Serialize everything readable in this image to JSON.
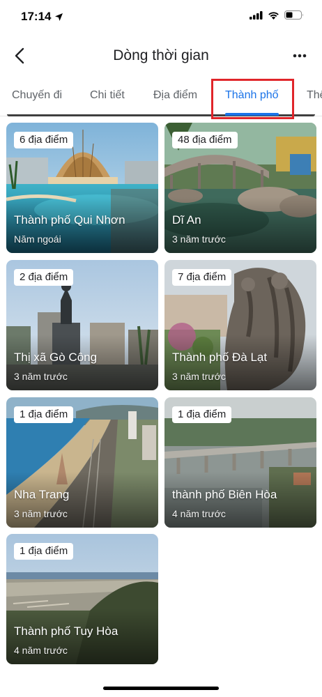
{
  "status_bar": {
    "time": "17:14"
  },
  "header": {
    "title": "Dòng thời gian"
  },
  "tabs": [
    {
      "label": "Chuyến đi",
      "active": false
    },
    {
      "label": "Chi tiết",
      "active": false
    },
    {
      "label": "Địa điểm",
      "active": false
    },
    {
      "label": "Thành phố",
      "active": true
    },
    {
      "label": "Thế",
      "active": false
    }
  ],
  "cities": [
    {
      "badge": "6 địa điểm",
      "name": "Thành phố Qui Nhơn",
      "time": "Năm ngoái"
    },
    {
      "badge": "48 địa điểm",
      "name": "Dĩ An",
      "time": "3 năm trước"
    },
    {
      "badge": "2 địa điểm",
      "name": "Thị xã Gò Công",
      "time": "3 năm trước"
    },
    {
      "badge": "7 địa điểm",
      "name": "Thành phố Đà Lạt",
      "time": "3 năm trước"
    },
    {
      "badge": "1 địa điểm",
      "name": "Nha Trang",
      "time": "3 năm trước"
    },
    {
      "badge": "1 địa điểm",
      "name": "thành phố Biên Hòa",
      "time": "4 năm trước"
    },
    {
      "badge": "1 địa điểm",
      "name": "Thành phố Tuy Hòa",
      "time": "4 năm trước"
    }
  ],
  "colors": {
    "accent": "#1a73e8",
    "highlight": "#e0252a"
  }
}
